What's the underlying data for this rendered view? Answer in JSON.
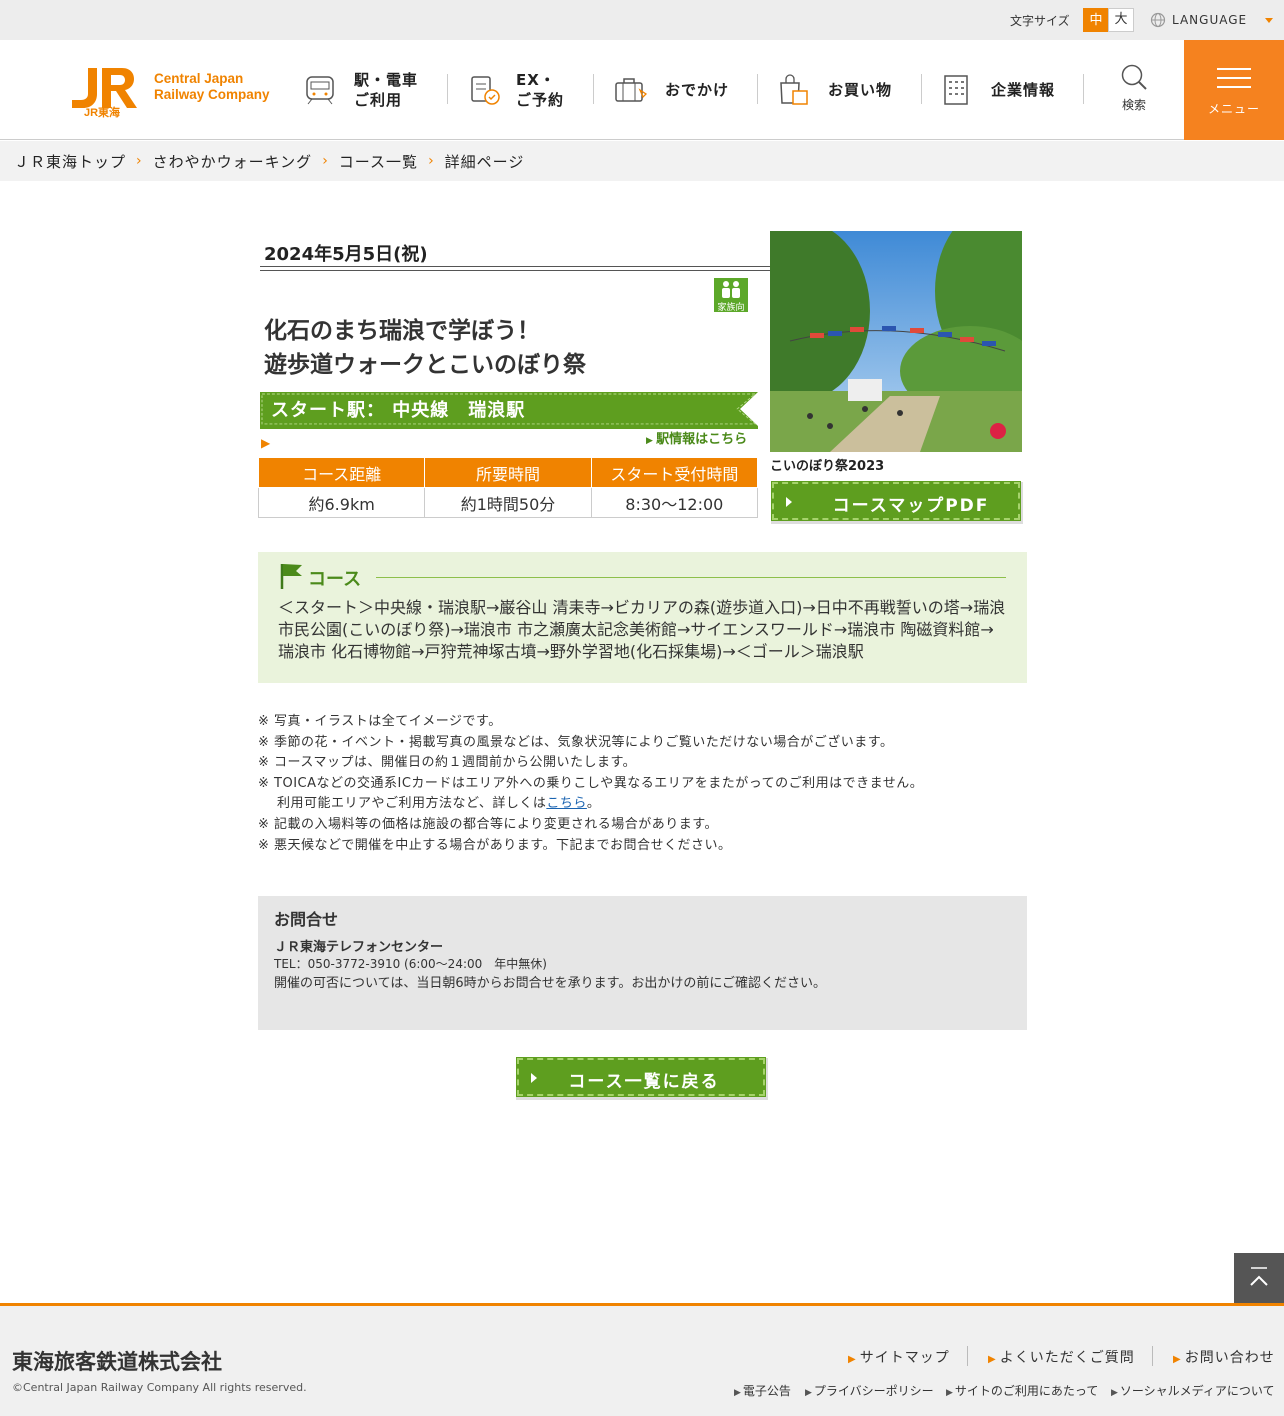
{
  "topbar": {
    "font_size_label": "文字サイズ",
    "size_medium": "中",
    "size_large": "大",
    "language": "LANGUAGE"
  },
  "header": {
    "logo_line1": "Central Japan",
    "logo_line2": "Railway Company",
    "logo_sub": "JR東海",
    "nav": [
      {
        "line1": "駅・電車",
        "line2": "ご利用"
      },
      {
        "line1": "EX・",
        "line2": "ご予約"
      },
      {
        "line1": "おでかけ",
        "line2": ""
      },
      {
        "line1": "お買い物",
        "line2": ""
      },
      {
        "line1": "企業情報",
        "line2": ""
      }
    ],
    "search_label": "検索",
    "menu_label": "メニュー"
  },
  "breadcrumb": [
    "ＪＲ東海トップ",
    "さわやかウォーキング",
    "コース一覧",
    "詳細ページ"
  ],
  "event": {
    "date": "2024年5月5日(祝)",
    "family_badge": "家族向",
    "title_line1": "化石のまち瑞浪で学ぼう！",
    "title_line2": "遊歩道ウォークとこいのぼり祭",
    "start_station": "スタート駅： 中央線　瑞浪駅",
    "station_link": "駅情報はこちら",
    "table_headers": [
      "コース距離",
      "所要時間",
      "スタート受付時間"
    ],
    "table_values": [
      "約6.9km",
      "約1時間50分",
      "8:30～12:00"
    ],
    "photo_caption": "こいのぼり祭2023",
    "pdf_button": "コースマップPDF"
  },
  "course": {
    "heading": "コース",
    "text": "＜スタート＞中央線・瑞浪駅→巌谷山 清耒寺→ビカリアの森(遊歩道入口)→日中不再戦誓いの塔→瑞浪市民公園(こいのぼり祭)→瑞浪市 市之瀬廣太記念美術館→サイエンスワールド→瑞浪市 陶磁資料館→瑞浪市 化石博物館→戸狩荒神塚古墳→野外学習地(化石採集場)→＜ゴール＞瑞浪駅"
  },
  "notes": [
    "※ 写真・イラストは全てイメージです。",
    "※ 季節の花・イベント・掲載写真の風景などは、気象状況等によりご覧いただけない場合がございます。",
    "※ コースマップは、開催日の約１週間前から公開いたします。",
    "※ TOICAなどの交通系ICカードはエリア外への乗りこしや異なるエリアをまたがってのご利用はできません。"
  ],
  "notes_indent": {
    "before": "利用可能エリアやご利用方法など、詳しくは",
    "link": "こちら",
    "after": "。"
  },
  "notes_after": [
    "※ 記載の入場料等の価格は施設の都合等により変更される場合があります。",
    "※ 悪天候などで開催を中止する場合があります。下記までお問合せください。"
  ],
  "contact": {
    "heading": "お問合せ",
    "name": "ＪＲ東海テレフォンセンター",
    "tel": "TEL：050-3772-3910 (6:00～24:00　年中無休)",
    "note": "開催の可否については、当日朝6時からお問合せを承ります。お出かけの前にご確認ください。"
  },
  "back_button": "コース一覧に戻る",
  "footer": {
    "company": "東海旅客鉄道株式会社",
    "copyright": "©Central Japan Railway Company All rights reserved.",
    "main_links": [
      "サイトマップ",
      "よくいただくご質問",
      "お問い合わせ"
    ],
    "sub_links": [
      "電子公告",
      "プライバシーポリシー",
      "サイトのご利用にあたって",
      "ソーシャルメディアについて"
    ]
  },
  "colors": {
    "accent": "#f08300",
    "green": "#5e9e1f",
    "course_bg": "#eaf3dc"
  }
}
